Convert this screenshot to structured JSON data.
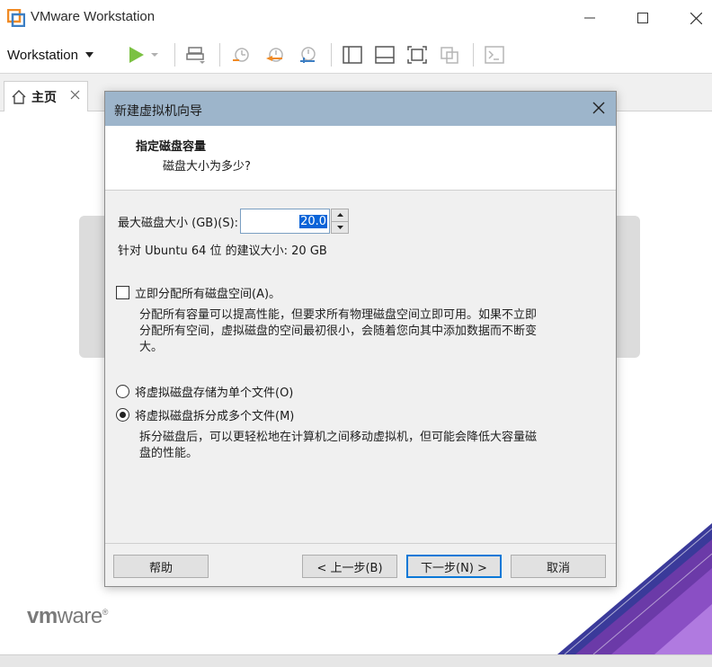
{
  "app": {
    "title": "VMware Workstation",
    "menu_label": "Workstation"
  },
  "tabs": [
    {
      "label": "主页"
    }
  ],
  "brand": {
    "logo_text_bold": "vm",
    "logo_text": "ware",
    "reg": "®"
  },
  "dialog": {
    "title": "新建虚拟机向导",
    "heading": "指定磁盘容量",
    "subheading": "磁盘大小为多少?",
    "disk_size_label": "最大磁盘大小 (GB)(S):",
    "disk_size_value": "20.0",
    "recommended": "针对 Ubuntu 64 位 的建议大小: 20 GB",
    "allocate_now": {
      "label": "立即分配所有磁盘空间(A)。",
      "checked": false,
      "desc_line1": "分配所有容量可以提高性能，但要求所有物理磁盘空间立即可用。如果不立即",
      "desc_line2": "分配所有空间，虚拟磁盘的空间最初很小，会随着您向其中添加数据而不断变",
      "desc_line3": "大。"
    },
    "storage_options": [
      {
        "label": "将虚拟磁盘存储为单个文件(O)",
        "selected": false
      },
      {
        "label": "将虚拟磁盘拆分成多个文件(M)",
        "selected": true
      }
    ],
    "split_desc_line1": "拆分磁盘后，可以更轻松地在计算机之间移动虚拟机，但可能会降低大容量磁",
    "split_desc_line2": "盘的性能。",
    "buttons": {
      "help": "帮助",
      "back": "< 上一步(B)",
      "next": "下一步(N) >",
      "cancel": "取消"
    }
  },
  "colors": {
    "dialog_titlebar": "#9db5cb",
    "play_green": "#7bc142",
    "accent_orange": "#f08a24",
    "focus_blue": "#0a78d7"
  }
}
